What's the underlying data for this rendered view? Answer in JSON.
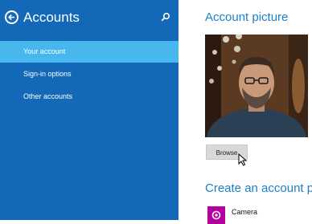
{
  "sidebar": {
    "title": "Accounts",
    "items": [
      {
        "label": "Your account",
        "selected": true
      },
      {
        "label": "Sign-in options",
        "selected": false
      },
      {
        "label": "Other accounts",
        "selected": false
      }
    ],
    "icons": {
      "back": "back-arrow-icon",
      "search": "search-icon"
    }
  },
  "main": {
    "picture_heading": "Account picture",
    "browse_label": "Browse",
    "create_heading": "Create an account pic",
    "apps": [
      {
        "label": "Camera",
        "icon": "camera-icon",
        "color": "#b4009e"
      }
    ]
  },
  "colors": {
    "sidebar_bg": "#1369b7",
    "selected_item": "#47b7ee",
    "heading": "#1c81c7",
    "camera_tile": "#b4009e"
  }
}
